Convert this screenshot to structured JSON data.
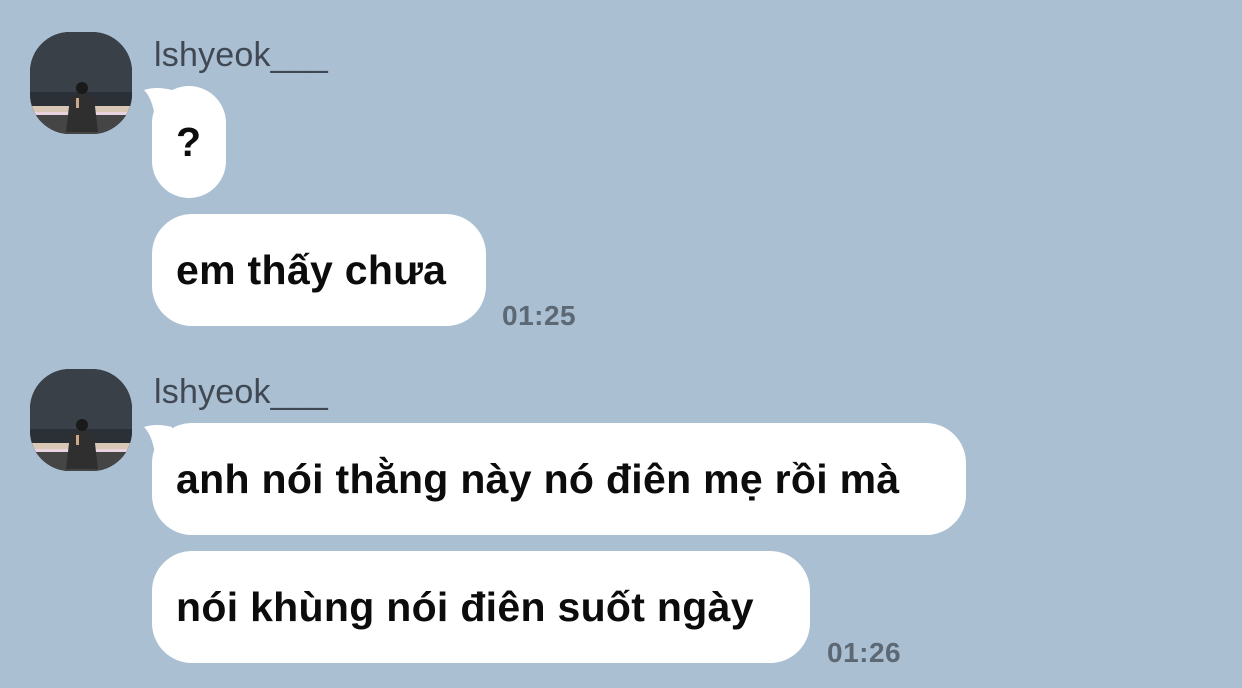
{
  "chat": {
    "background_color": "#aabfd2",
    "bubble_color": "#ffffff",
    "groups": [
      {
        "sender": "lshyeok___",
        "messages": [
          {
            "text": "?"
          },
          {
            "text": "em thấy chưa"
          }
        ],
        "time": "01:25"
      },
      {
        "sender": "lshyeok___",
        "messages": [
          {
            "text": "anh nói thằng này nó điên mẹ rồi mà"
          },
          {
            "text": "nói khùng nói điên suốt ngày"
          }
        ],
        "time": "01:26"
      }
    ]
  }
}
